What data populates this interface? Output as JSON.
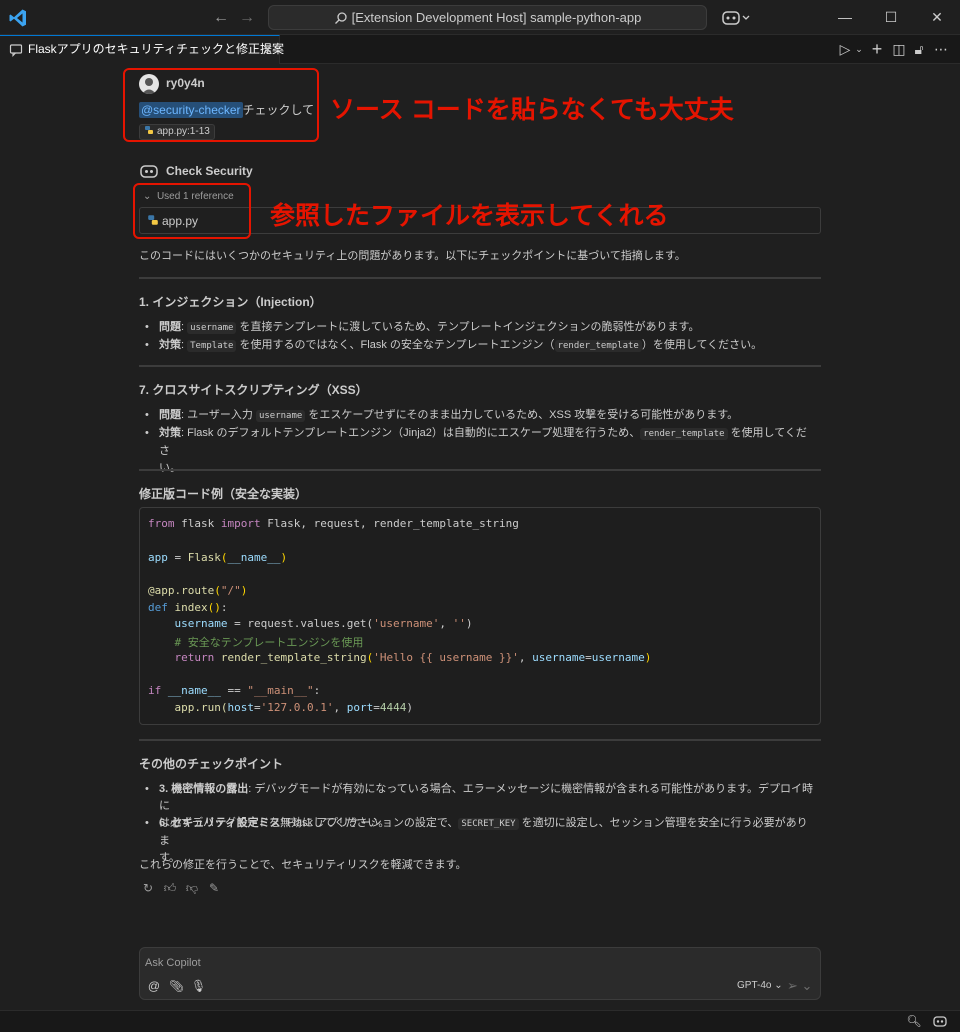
{
  "window": {
    "search_text": "[Extension Development Host] sample-python-app"
  },
  "tab": {
    "title": "Flaskアプリのセキュリティチェックと修正提案"
  },
  "request": {
    "username": "ry0y4n",
    "mention": "@security-checker",
    "message": "チェックして",
    "attachment": "app.py:1-13"
  },
  "response": {
    "agent_name": "Check Security",
    "used_reference": "Used 1 reference",
    "reference_file": "app.py",
    "intro": "このコードにはいくつかのセキュリティ上の問題があります。以下にチェックポイントに基づいて指摘します。",
    "section1": {
      "heading": "1. インジェクション（Injection）",
      "b1_label": "問題",
      "b1_code": "username",
      "b1_text": "を直接テンプレートに渡しているため、テンプレートインジェクションの脆弱性があります。",
      "b2_label": "対策",
      "b2_code": "Template",
      "b2_text1": "を使用するのではなく、Flask の安全なテンプレートエンジン（",
      "b2_code2": "render_template",
      "b2_text2": "）を使用してください。"
    },
    "section2": {
      "heading": "7. クロスサイトスクリプティング（XSS）",
      "b1_label": "問題",
      "b1_text1": "ユーザー入力",
      "b1_code": "username",
      "b1_text2": "をエスケープせずにそのまま出力しているため、XSS 攻撃を受ける可能性があります。",
      "b2_label": "対策",
      "b2_text1": "Flask のデフォルトテンプレートエンジン（Jinja2）は自動的にエスケープ処理を行うため、",
      "b2_code": "render_template",
      "b2_text2": "を使用してくださ",
      "b2_text3": "い。"
    },
    "code_heading": "修正版コード例（安全な実装）",
    "code": {
      "l1_from": "from",
      "l1_mod": "flask",
      "l1_import": "import",
      "l1_rest": "Flask, request, render_template_string",
      "l3_var": "app",
      "l3_eq": " = ",
      "l3_fn": "Flask",
      "l3_arg": "__name__",
      "l5_dec": "@app.route",
      "l5_str": "\"/\"",
      "l6_def": "def",
      "l6_fn": "index",
      "l7_var": "username",
      "l7_mid": " = request.values.get(",
      "l7_s1": "'username'",
      "l7_s2": "''",
      "l8_comment": "# 安全なテンプレートエンジンを使用",
      "l9_return": "return",
      "l9_fn": "render_template_string",
      "l9_s1": "'Hello {{ username }}'",
      "l9_kw": "username",
      "l9_val": "username",
      "l11_if": "if",
      "l11_var": "__name__",
      "l11_op": " == ",
      "l11_str": "\"__main__\"",
      "l12_call": "app.run(",
      "l12_host": "host",
      "l12_hostval": "'127.0.0.1'",
      "l12_port": "port",
      "l12_portval": "4444"
    },
    "section3": {
      "heading": "その他のチェックポイント",
      "b1_label": "3. 機密情報の露出",
      "b1_text1": "デバッグモードが有効になっている場合、エラーメッセージに機密情報が含まれる可能性があります。デプロイ時に",
      "b1_text2": "は必ずデバッグモードを無効にしてください。",
      "b2_label": "6. セキュリティ設定ミス",
      "b2_text1": "Flask アプリケーションの設定で、",
      "b2_code": "SECRET_KEY",
      "b2_text2": "を適切に設定し、セッション管理を安全に行う必要がありま",
      "b2_text3": "す。"
    },
    "conclusion": "これらの修正を行うことで、セキュリティリスクを軽減できます。"
  },
  "annotations": {
    "a1": "ソース コードを貼らなくても大丈夫",
    "a2": "参照したファイルを表示してくれる"
  },
  "input": {
    "placeholder": "Ask Copilot",
    "model": "GPT-4o"
  },
  "colors": {
    "accent": "#0078d4",
    "annotation_red": "#e51400",
    "background": "#1f1f1f"
  }
}
